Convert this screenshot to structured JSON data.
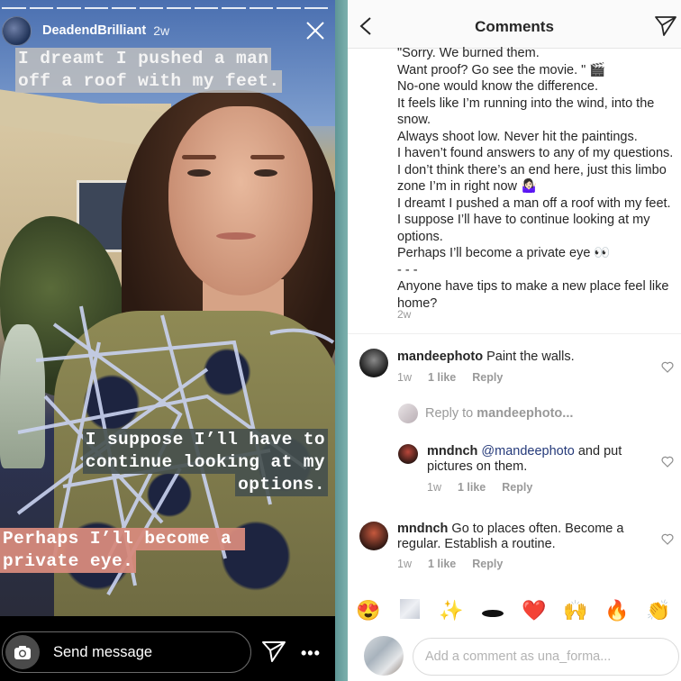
{
  "story": {
    "progress_segments": 12,
    "username": "DeadendBrilliant",
    "time": "2w",
    "captions": {
      "top": [
        "I dreamt I pushed a man",
        "off a roof with my feet."
      ],
      "middle": [
        "I suppose I’ll have to",
        "continue looking at my",
        "options."
      ],
      "bottom": [
        "Perhaps I’ll become a ",
        "private eye."
      ]
    },
    "footer": {
      "send_message_label": "Send message",
      "more_label": "•••"
    }
  },
  "comments_panel": {
    "title": "Comments",
    "caption_lines": [
      "\"Sorry. We burned them.",
      "Want proof? Go see the movie. \" 🎬",
      "No-one would know the difference.",
      "It feels like I’m running into the wind, into the snow.",
      "Always shoot low. Never hit the paintings.",
      "I haven’t found answers to any of my questions.",
      "I don’t think there’s an end here, just this limbo zone I’m in right now 🤷🏻‍♀️",
      "I dreamt I pushed a man off a roof with my feet.",
      "I suppose I’ll have to continue looking at my options.",
      "Perhaps I’ll become a private eye 👀",
      "- - -",
      "Anyone have tips to make a new place feel like home?"
    ],
    "caption_time": "2w",
    "comments": [
      {
        "username": "mandeephoto",
        "text": "Paint the walls.",
        "time": "1w",
        "likes": "1 like",
        "reply_label": "Reply"
      },
      {
        "username": "mndnch",
        "mention": "@mandeephoto",
        "text": "and put pictures on them.",
        "time": "1w",
        "likes": "1 like",
        "reply_label": "Reply"
      },
      {
        "username": "mndnch",
        "text": "Go to places often. Become a regular. Establish a routine.",
        "time": "1w",
        "likes": "1 like",
        "reply_label": "Reply"
      }
    ],
    "reply_prompt": {
      "prefix": "Reply to ",
      "target": "mandeephoto..."
    },
    "quick_emojis": [
      "😍",
      "blank",
      "✨",
      "hole",
      "❤️",
      "🙌",
      "🔥",
      "👏"
    ],
    "add_comment_placeholder": "Add a comment as una_forma..."
  }
}
